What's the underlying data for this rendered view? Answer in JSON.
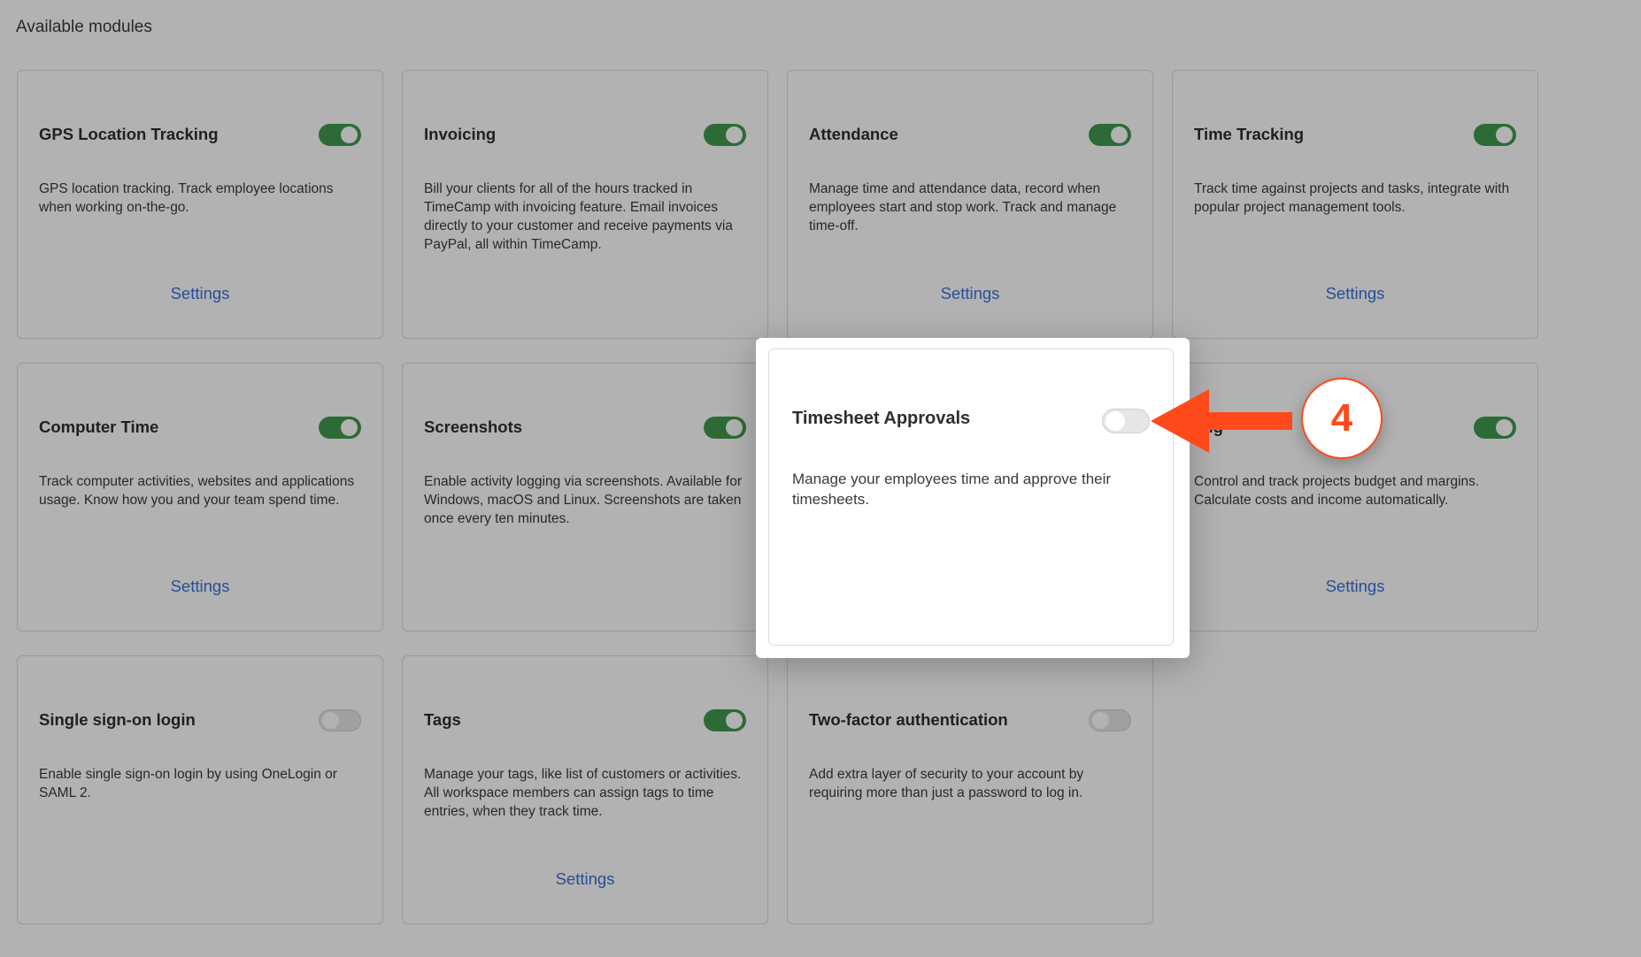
{
  "section_title": "Available modules",
  "colors": {
    "toggle_on": "#3f9a4e",
    "toggle_off": "#e6e6e6",
    "link": "#3a6fd8",
    "annotation": "#ff4a1c"
  },
  "modules": [
    {
      "title": "GPS Location Tracking",
      "desc": "GPS location tracking. Track employee locations when working on-the-go.",
      "enabled": true,
      "settings": "Settings"
    },
    {
      "title": "Invoicing",
      "desc": "Bill your clients for all of the hours tracked in TimeCamp with invoicing feature. Email invoices directly to your customer and receive payments via PayPal, all within TimeCamp.",
      "enabled": true,
      "settings": ""
    },
    {
      "title": "Attendance",
      "desc": "Manage time and attendance data, record when employees start and stop work. Track and manage time-off.",
      "enabled": true,
      "settings": "Settings"
    },
    {
      "title": "Time Tracking",
      "desc": "Track time against projects and tasks, integrate with popular project management tools.",
      "enabled": true,
      "settings": "Settings"
    },
    {
      "title": "Computer Time",
      "desc": "Track computer activities, websites and applications usage. Know how you and your team spend time.",
      "enabled": true,
      "settings": "Settings"
    },
    {
      "title": "Screenshots",
      "desc": "Enable activity logging via screenshots. Available for Windows, macOS and Linux. Screenshots are taken once every ten minutes.",
      "enabled": true,
      "settings": ""
    },
    {
      "title": "",
      "desc": "",
      "enabled": true,
      "settings": ""
    },
    {
      "title": "ling",
      "desc": "Control and track projects budget and margins. Calculate costs and income automatically.",
      "enabled": true,
      "settings": "Settings"
    },
    {
      "title": "Single sign-on login",
      "desc": "Enable single sign-on login by using OneLogin or SAML 2.",
      "enabled": false,
      "settings": ""
    },
    {
      "title": "Tags",
      "desc": "Manage your tags, like list of customers or activities. All workspace members can assign tags to time entries, when they track time.",
      "enabled": true,
      "settings": "Settings"
    },
    {
      "title": "Two-factor authentication",
      "desc": "Add extra layer of security to your account by requiring more than just a password to log in.",
      "enabled": false,
      "settings": ""
    }
  ],
  "modal": {
    "title": "Timesheet Approvals",
    "desc": "Manage your employees time and approve their timesheets.",
    "enabled": false
  },
  "annotation": {
    "step": "4",
    "icon": "arrow-left-icon"
  }
}
